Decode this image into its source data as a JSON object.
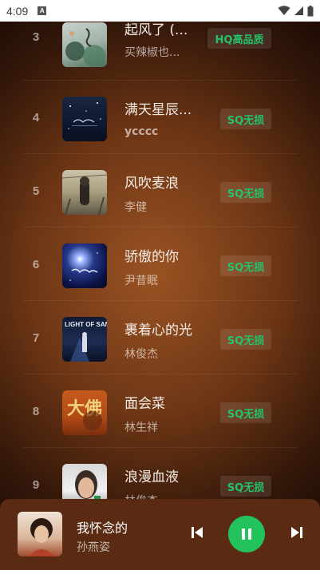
{
  "status_bar": {
    "time": "4:09",
    "notification_letter": "A"
  },
  "colors": {
    "accent_green": "#22c25d",
    "badge_text": "#24c36a"
  },
  "tracks": [
    {
      "rank": "3",
      "title": "起风了 (...",
      "artist": "买辣椒也...",
      "quality": "HQ高品质",
      "cover_icon": "album-cover-qifengle"
    },
    {
      "rank": "4",
      "title": "满天星辰...",
      "artist": "ycccc",
      "quality": "SQ无损",
      "cover_icon": "album-cover-mantianxingchen"
    },
    {
      "rank": "5",
      "title": "风吹麦浪",
      "artist": "李健",
      "quality": "SQ无损",
      "cover_icon": "album-cover-fengchuimailang"
    },
    {
      "rank": "6",
      "title": "骄傲的你",
      "artist": "尹昔眠",
      "quality": "SQ无损",
      "cover_icon": "album-cover-jiaoaodeni"
    },
    {
      "rank": "7",
      "title": "裹着心的光",
      "artist": "林俊杰",
      "quality": "SQ无损",
      "cover_icon": "album-cover-light-of-sanctuary",
      "cover_text": "LIGHT OF SANCTUARY"
    },
    {
      "rank": "8",
      "title": "面会菜",
      "artist": "林生祥",
      "quality": "SQ无损",
      "cover_icon": "album-cover-mianhuicai",
      "cover_text": "大佛"
    },
    {
      "rank": "9",
      "title": "浪漫血液",
      "artist": "林俊杰",
      "quality": "SQ无损",
      "cover_icon": "album-cover-langmanxueye"
    }
  ],
  "player": {
    "title": "我怀念的",
    "artist": "孙燕姿",
    "prev_icon": "skip-previous-icon",
    "play_icon": "pause-icon",
    "next_icon": "skip-next-icon"
  }
}
